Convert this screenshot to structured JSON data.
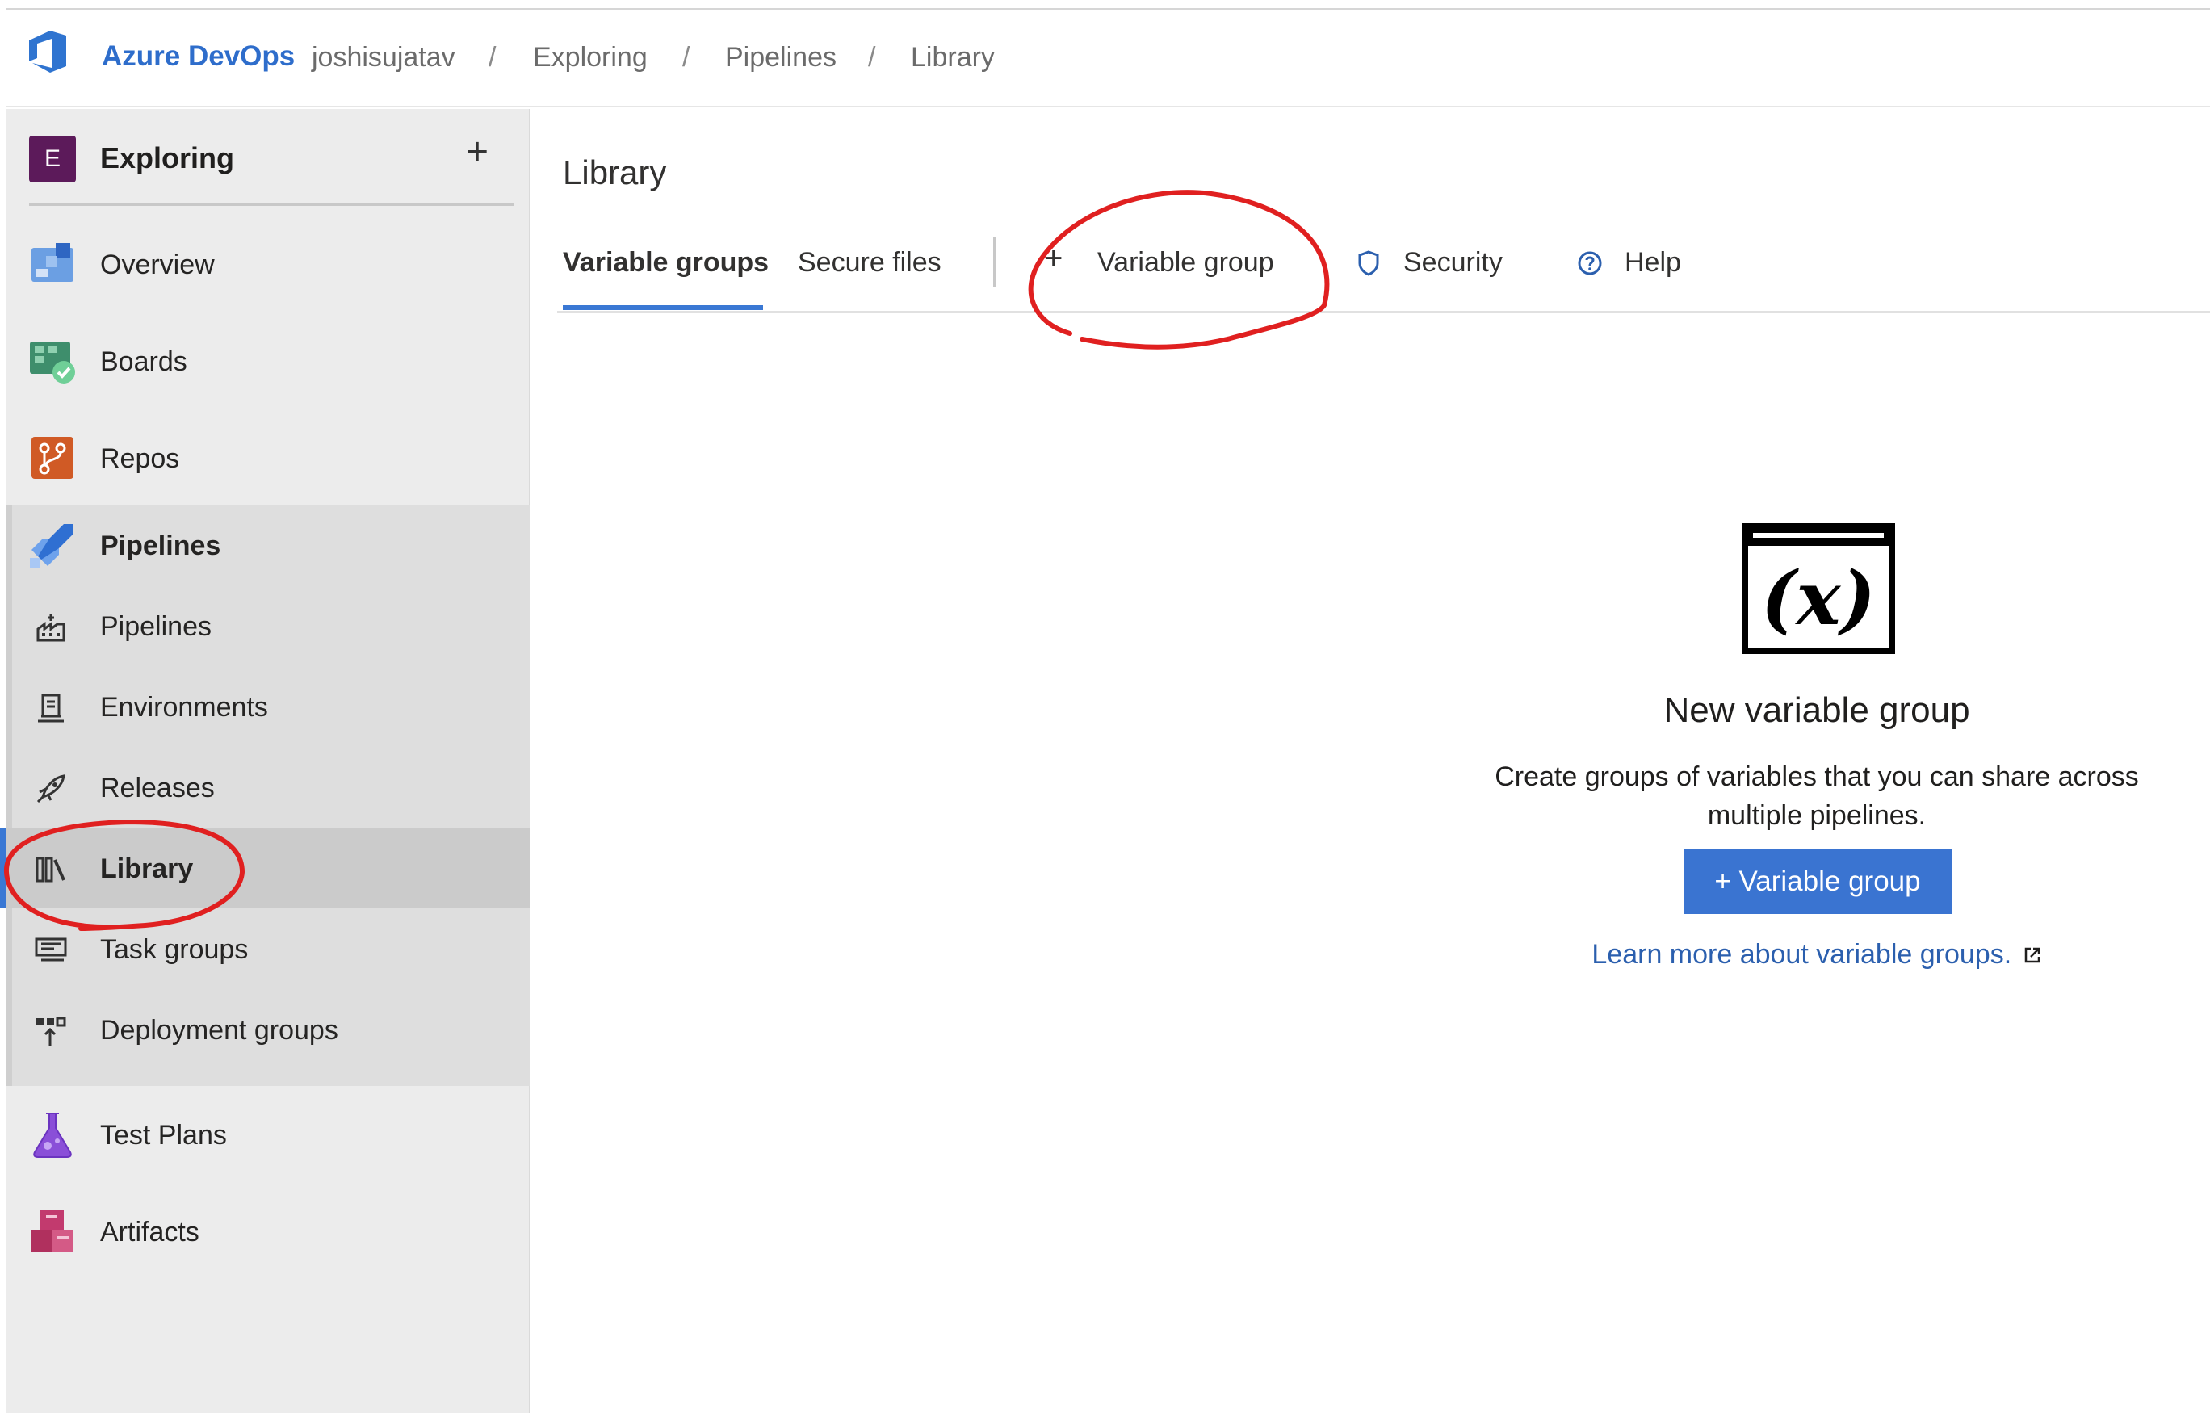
{
  "header": {
    "brand": "Azure DevOps",
    "breadcrumbs": [
      "joshisujatav",
      "Exploring",
      "Pipelines",
      "Library"
    ],
    "separator": "/"
  },
  "sidebar": {
    "project_initial": "E",
    "project_name": "Exploring",
    "add_symbol": "+",
    "items": [
      {
        "label": "Overview",
        "icon": "overview-icon"
      },
      {
        "label": "Boards",
        "icon": "boards-icon"
      },
      {
        "label": "Repos",
        "icon": "repos-icon"
      },
      {
        "label": "Pipelines",
        "icon": "pipelines-icon"
      },
      {
        "label": "Test Plans",
        "icon": "test-plans-icon"
      },
      {
        "label": "Artifacts",
        "icon": "artifacts-icon"
      }
    ],
    "sub_items": [
      {
        "label": "Pipelines",
        "icon": "pipelines-sub-icon"
      },
      {
        "label": "Environments",
        "icon": "environments-icon"
      },
      {
        "label": "Releases",
        "icon": "releases-icon"
      },
      {
        "label": "Library",
        "icon": "library-icon",
        "selected": true
      },
      {
        "label": "Task groups",
        "icon": "task-groups-icon"
      },
      {
        "label": "Deployment groups",
        "icon": "deployment-groups-icon"
      }
    ]
  },
  "main": {
    "title": "Library",
    "tabs": [
      {
        "label": "Variable groups",
        "active": true
      },
      {
        "label": "Secure files",
        "active": false
      }
    ],
    "commands": {
      "add_variable_group": "Variable group",
      "add_symbol": "+",
      "security": "Security",
      "help": "Help"
    },
    "empty_state": {
      "icon_text": "(x)",
      "title": "New variable group",
      "description": "Create groups of variables that you can share across multiple pipelines.",
      "button": "+ Variable group",
      "learn_more": "Learn more about variable groups."
    }
  },
  "colors": {
    "brand_blue": "#2e6dcb",
    "accent": "#3a78d4",
    "primary_button": "#3a74d1",
    "link": "#2b5fae",
    "project_badge": "#5c1a5a",
    "annotation_red": "#e02020"
  }
}
